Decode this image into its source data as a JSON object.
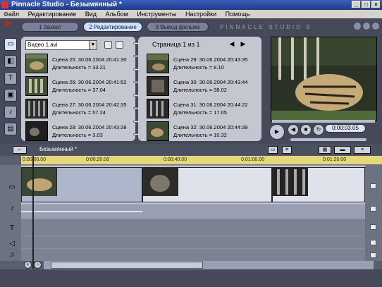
{
  "window": {
    "title": "Pinnacle Studio - Безымянный *"
  },
  "menu": [
    "Файл",
    "Редактирование",
    "Вид",
    "Альбом",
    "Инструменты",
    "Настройки",
    "Помощь"
  ],
  "modes": [
    "1 Захват",
    "2 Редактирование",
    "3 Вывод фильма"
  ],
  "brand": "PINNACLE STUDIO 9",
  "album": {
    "dropdown": "Видео 1.avi",
    "page_label": "Страница 1 из 1",
    "left_scenes": [
      {
        "l1": "Сцена 25: 30.06.2004 20:41:30",
        "l2": "Длительность = 33.21"
      },
      {
        "l1": "Сцена 26: 30.06.2004 20:41:52",
        "l2": "Длительность = 37.04"
      },
      {
        "l1": "Сцена 27: 30.06.2004 20:42:35",
        "l2": "Длительность = 57.24"
      },
      {
        "l1": "Сцена 28: 30.06.2004 20:43:38",
        "l2": "Длительность = 3.03"
      }
    ],
    "right_scenes": [
      {
        "l1": "Сцена 29: 30.06.2004 20:43:35",
        "l2": "Длительность = 8.10"
      },
      {
        "l1": "Сцена 30: 30.06.2004 20:43:44",
        "l2": "Длительность = 38.02"
      },
      {
        "l1": "Сцена 31: 30.06.2004 20:44:22",
        "l2": "Длительность = 17.05"
      },
      {
        "l1": "Сцена 32: 30.06.2004 20:44:39",
        "l2": "Длительность = 10.32"
      }
    ]
  },
  "preview": {
    "timecode": "0:00:03.05"
  },
  "timeline": {
    "project_name": "Безымянный *",
    "ruler": [
      "0:00:00.00",
      "0:00:20.00",
      "0:00:40.00",
      "0:01:00.00",
      "0:01:20.00"
    ]
  }
}
